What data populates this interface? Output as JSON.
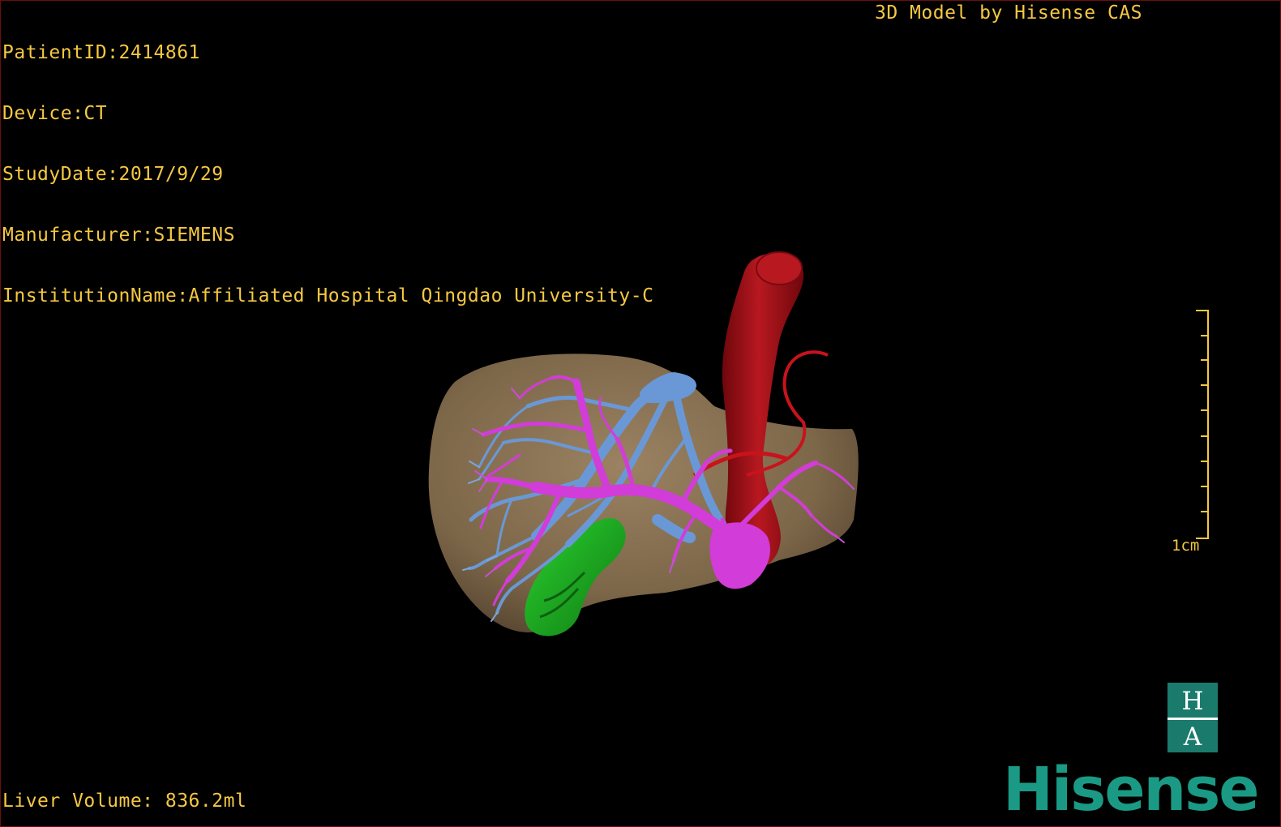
{
  "patient_info": {
    "patient_id": "PatientID:2414861",
    "device": "Device:CT",
    "study_date": "StudyDate:2017/9/29",
    "manufacturer": "Manufacturer:SIEMENS",
    "institution": "InstitutionName:Affiliated Hospital Qingdao University-C"
  },
  "model_credit": "3D Model by Hisense CAS",
  "liver_volume": "Liver Volume: 836.2ml",
  "scale": {
    "label": "1cm",
    "color": "#f5c842"
  },
  "logo": {
    "letter_top": "H",
    "letter_bottom": "A",
    "wordmark": "Hisense",
    "color": "#1a9a85"
  },
  "colors": {
    "overlay_text": "#f5c842",
    "liver": "#8a7355",
    "hepatic_vein": "#6a98d6",
    "portal_vein": "#d23cd8",
    "vena_cava": "#a30f18",
    "gallbladder": "#1fb524",
    "background": "#000000"
  }
}
